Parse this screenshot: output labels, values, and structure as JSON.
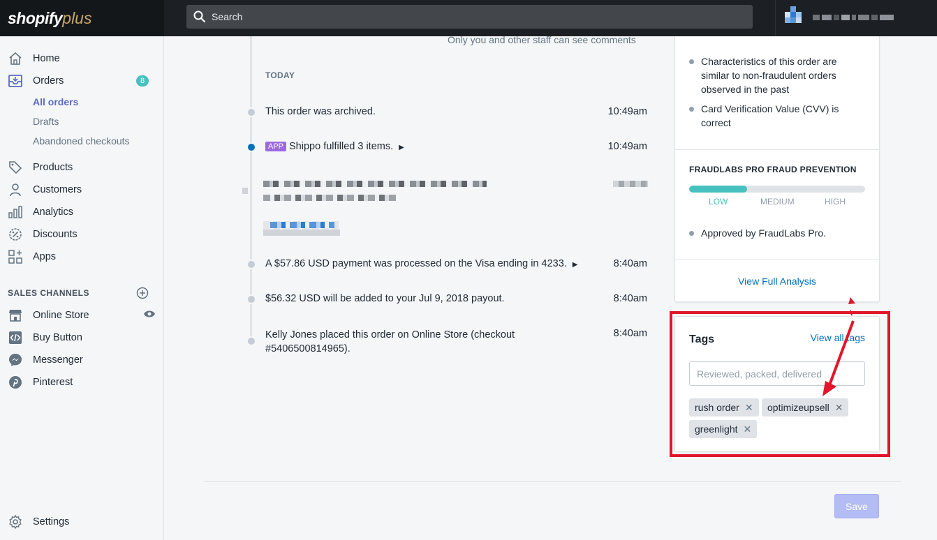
{
  "topbar": {
    "logo_main": "shopify",
    "logo_plus": "plus",
    "search_placeholder": "Search"
  },
  "sidebar": {
    "items": [
      {
        "label": "Home",
        "icon": "home-icon"
      },
      {
        "label": "Orders",
        "icon": "orders-icon",
        "badge": "8"
      },
      {
        "label": "Products",
        "icon": "tag-icon"
      },
      {
        "label": "Customers",
        "icon": "person-icon"
      },
      {
        "label": "Analytics",
        "icon": "bar-chart-icon"
      },
      {
        "label": "Discounts",
        "icon": "discount-icon"
      },
      {
        "label": "Apps",
        "icon": "apps-icon"
      }
    ],
    "order_subitems": [
      "All orders",
      "Drafts",
      "Abandoned checkouts"
    ],
    "sales_channels_title": "SALES CHANNELS",
    "channels": [
      {
        "label": "Online Store",
        "icon": "store-icon"
      },
      {
        "label": "Buy Button",
        "icon": "code-icon"
      },
      {
        "label": "Messenger",
        "icon": "messenger-icon"
      },
      {
        "label": "Pinterest",
        "icon": "pinterest-icon"
      }
    ],
    "settings_label": "Settings"
  },
  "timeline": {
    "comments_note": "Only you and other staff can see comments",
    "day_label": "TODAY",
    "events": [
      {
        "text": "This order was archived.",
        "time": "10:49am"
      },
      {
        "badge": "APP",
        "text": "Shippo fulfilled 3 items.",
        "time": "10:49am"
      },
      {
        "text": "A $57.86 USD payment was processed on the Visa ending in 4233.",
        "time": "8:40am"
      },
      {
        "text": "$56.32 USD will be added to your Jul 9, 2018 payout.",
        "time": "8:40am"
      },
      {
        "text": "Kelly Jones placed this order on Online Store (checkout #5406500814965).",
        "time": "8:40am"
      }
    ]
  },
  "fraud": {
    "bullets": [
      "Characteristics of this order are similar to non-fraudulent orders observed in the past",
      "Card Verification Value (CVV) is correct"
    ],
    "title": "FRAUDLABS PRO FRAUD PREVENTION",
    "risk_levels": [
      "LOW",
      "MEDIUM",
      "HIGH"
    ],
    "risk_level": 0.33,
    "approval": "Approved by FraudLabs Pro.",
    "view_full": "View Full Analysis"
  },
  "tags": {
    "title": "Tags",
    "view_all": "View all tags",
    "placeholder": "Reviewed, packed, delivered",
    "chips": [
      "rush order",
      "optimizeupsell",
      "greenlight"
    ]
  },
  "footer": {
    "save_label": "Save"
  },
  "colors": {
    "accent": "#5c6ac4",
    "link": "#006fbb",
    "teal": "#47c1bf",
    "highlight": "#e0162b"
  }
}
